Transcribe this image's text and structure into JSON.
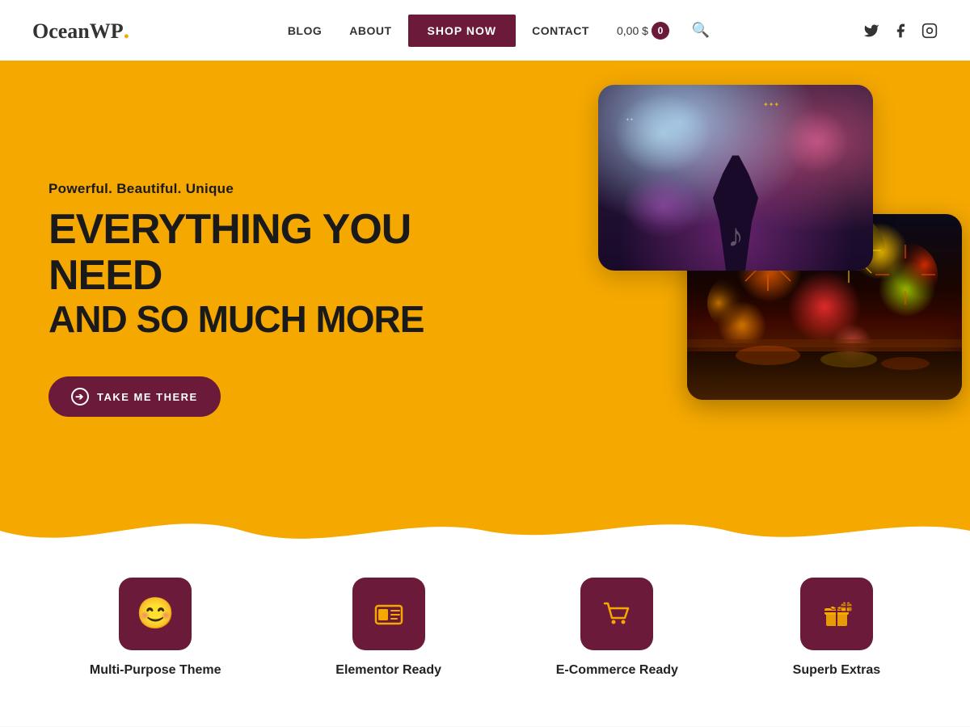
{
  "header": {
    "logo_text": "OceanWP",
    "logo_dot": ".",
    "nav_items": [
      {
        "label": "BLOG",
        "type": "link"
      },
      {
        "label": "ABOUT",
        "type": "link"
      },
      {
        "label": "SHOP NOW",
        "type": "button"
      },
      {
        "label": "CONTACT",
        "type": "link"
      }
    ],
    "cart_price": "0,00 $",
    "cart_count": "0",
    "social_icons": [
      "twitter",
      "facebook",
      "instagram"
    ]
  },
  "hero": {
    "subtitle": "Powerful. Beautiful. Unique",
    "title_line1": "EVERYTHING YOU NEED",
    "title_line2": "AND SO MUCH MORE",
    "cta_label": "TAKE ME THERE"
  },
  "features": [
    {
      "icon": "😊",
      "label": "Multi-Purpose Theme"
    },
    {
      "icon": "🪪",
      "label": "Elementor Ready"
    },
    {
      "icon": "🛒",
      "label": "E-Commerce Ready"
    },
    {
      "icon": "🎁",
      "label": "Superb Extras"
    }
  ],
  "colors": {
    "yellow": "#f4a800",
    "dark_red": "#6b1a3a",
    "dark": "#1a1a1a",
    "white": "#ffffff"
  }
}
